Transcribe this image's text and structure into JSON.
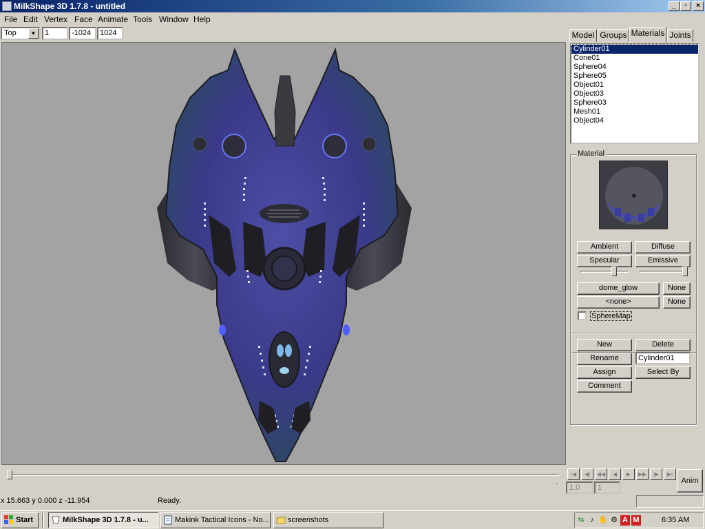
{
  "window": {
    "title": "MilkShape 3D 1.7.8 - untitled"
  },
  "menu": [
    "File",
    "Edit",
    "Vertex",
    "Face",
    "Animate",
    "Tools",
    "Window",
    "Help"
  ],
  "viewbar": {
    "view": "Top",
    "field1": "1",
    "field2": "-1024",
    "field3": "1024"
  },
  "tabs": [
    {
      "label": "Model",
      "active": false
    },
    {
      "label": "Groups",
      "active": false
    },
    {
      "label": "Materials",
      "active": true
    },
    {
      "label": "Joints",
      "active": false
    }
  ],
  "materials": {
    "items": [
      "Cylinder01",
      "Cone01",
      "Sphere04",
      "Sphere05",
      "Object01",
      "Object03",
      "Sphere03",
      "Mesh01",
      "Object04"
    ],
    "selected_index": 0
  },
  "material_panel": {
    "title": "Material",
    "buttons": {
      "ambient": "Ambient",
      "diffuse": "Diffuse",
      "specular": "Specular",
      "emissive": "Emissive"
    },
    "texture1": "dome_glow",
    "texture1_none": "None",
    "texture2": "<none>",
    "texture2_none": "None",
    "spheremap_label": "SphereMap",
    "spheremap_checked": false,
    "shininess_level": 0.72,
    "transparency_level": 1.0
  },
  "material_actions": {
    "new": "New",
    "delete": "Delete",
    "rename": "Rename",
    "rename_value": "Cylinder01",
    "assign": "Assign",
    "select_by": "Select By",
    "comment": "Comment"
  },
  "timeline": {
    "frame": "1.0",
    "end_frame": "1",
    "anim_label": "Anim",
    "position": 0.0
  },
  "status": {
    "coords": "x 15.663 y 0.000 z -11.954",
    "message": "Ready."
  },
  "taskbar": {
    "start": "Start",
    "tasks": [
      {
        "label": "MilkShape 3D 1.7.8 - u...",
        "active": true,
        "icon": "milkshape-icon"
      },
      {
        "label": "Makink Tactical Icons - No...",
        "active": false,
        "icon": "notepad-icon"
      },
      {
        "label": "screenshots",
        "active": false,
        "icon": "folder-icon"
      }
    ],
    "clock": "6:35 AM"
  },
  "colors": {
    "titlebar": "#0a246a",
    "viewport_bg": "#a3a3a3",
    "hull_blue": "#3b3a8a",
    "hull_dark": "#2c2c33",
    "glow": "#cfe0ff"
  }
}
